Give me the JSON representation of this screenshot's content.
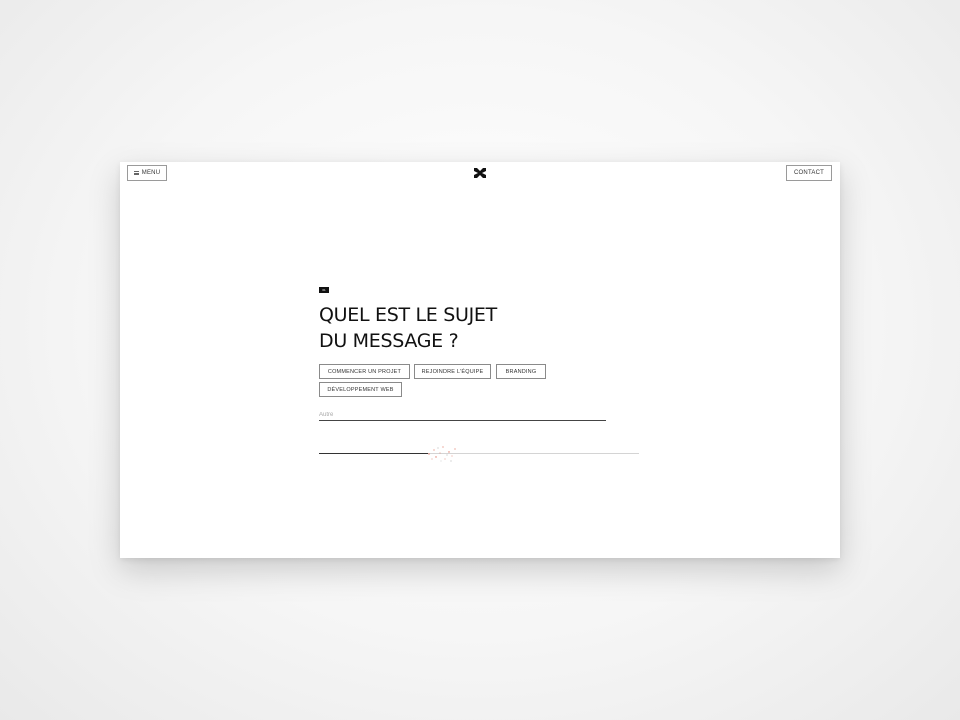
{
  "header": {
    "menu_label": "MENU",
    "contact_label": "CONTACT"
  },
  "form": {
    "step_badge": "01",
    "question_line1": "QUEL EST LE SUJET",
    "question_line2": "DU MESSAGE ?",
    "options": [
      {
        "label": "COMMENCER UN PROJET"
      },
      {
        "label": "REJOINDRE L'ÉQUIPE"
      },
      {
        "label": "BRANDING"
      },
      {
        "label": "DÉVELOPPEMENT WEB"
      }
    ],
    "other_placeholder": "Autre",
    "other_value": "",
    "progress_fraction": 0.34
  },
  "icons": {
    "menu": "hamburger-icon",
    "logo": "brand-logo-icon"
  },
  "colors": {
    "background": "#ffffff",
    "text": "#111111",
    "accent_sparkle": "#e07a6a"
  }
}
